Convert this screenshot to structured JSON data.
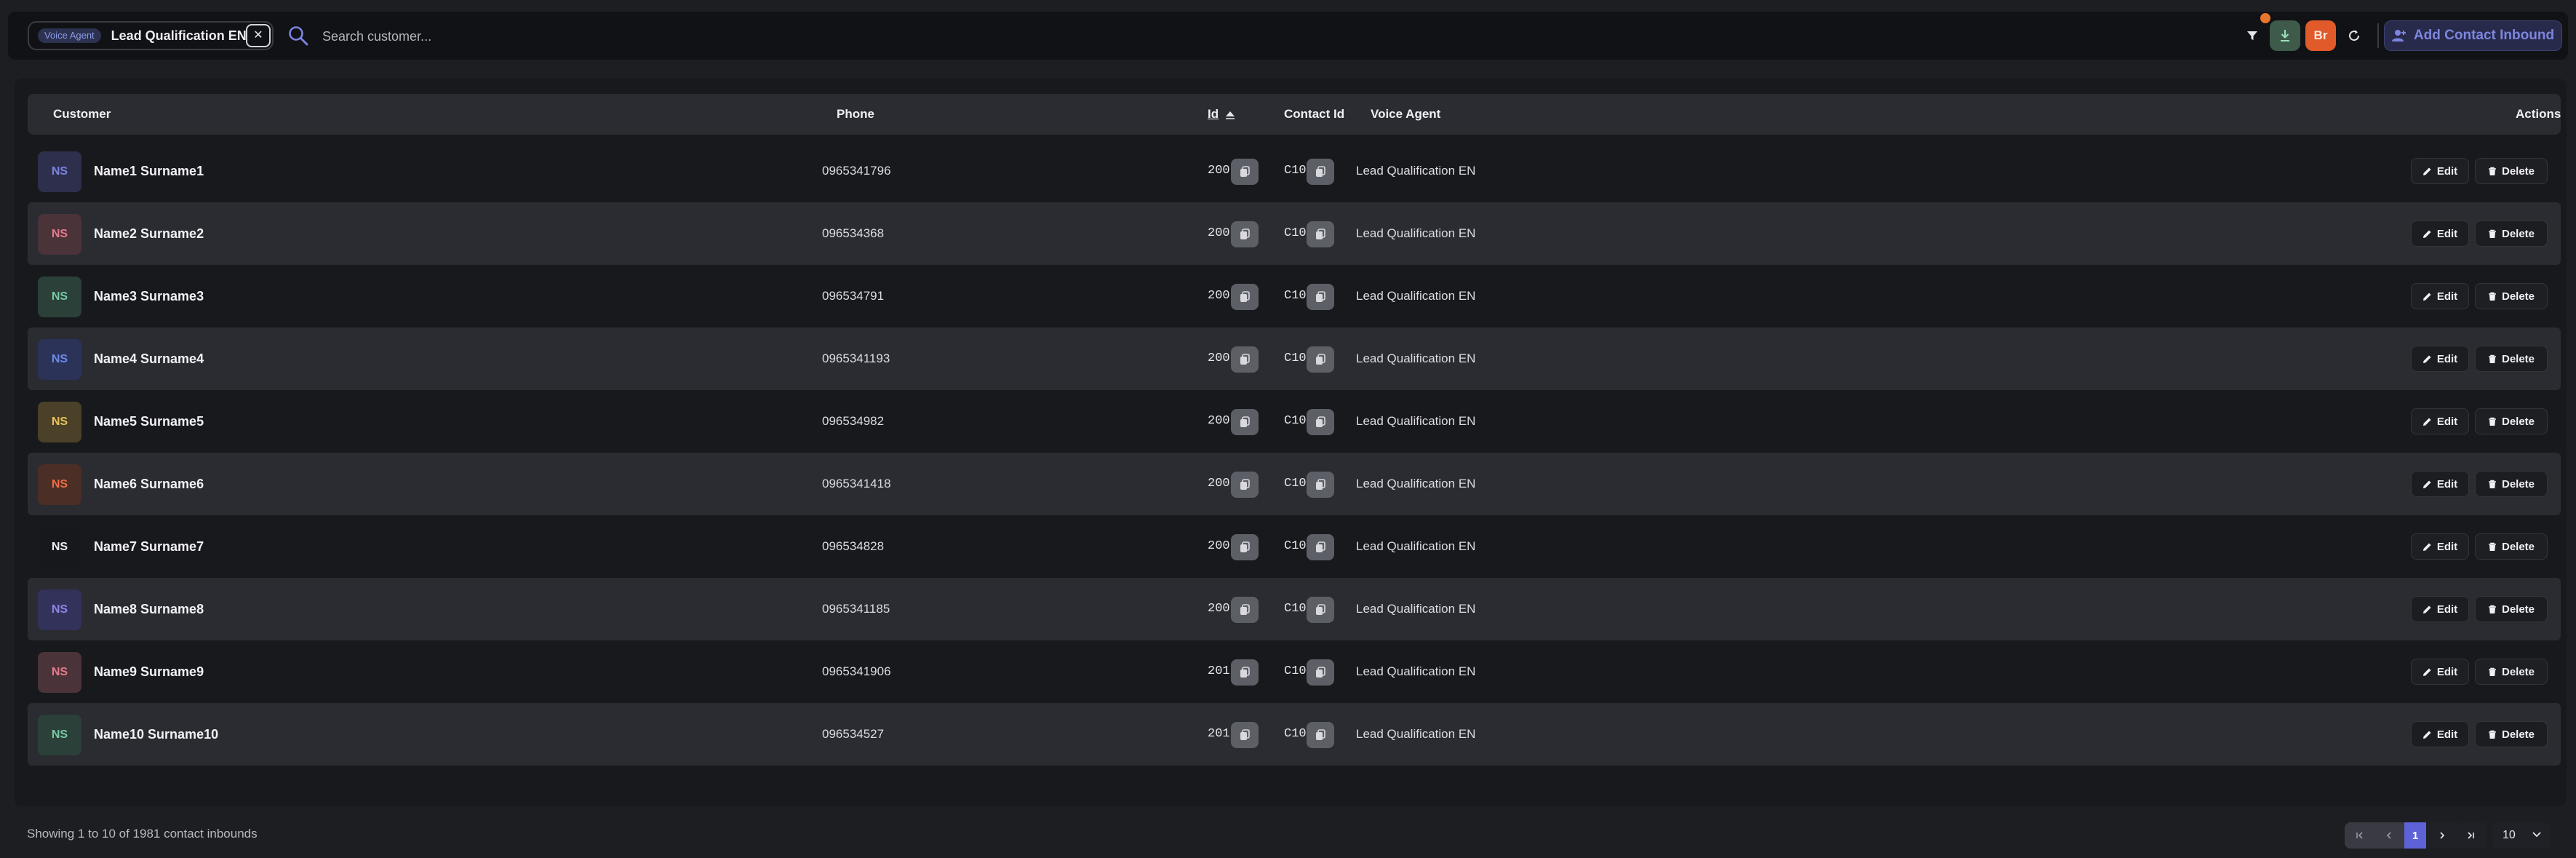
{
  "header": {
    "filter_chip": {
      "label": "Voice Agent",
      "value": "Lead Qualification EN",
      "clear_icon": "close-icon"
    },
    "search": {
      "placeholder": "Search customer...",
      "icon": "search-icon"
    },
    "toolbar": {
      "filter_icon": "filter-icon",
      "download_icon": "download-icon",
      "user_initials": "Br",
      "refresh_icon": "refresh-icon",
      "add_label": "Add Contact Inbound",
      "add_icon": "add-user-icon"
    }
  },
  "table": {
    "columns": {
      "customer": "Customer",
      "phone": "Phone",
      "id": "Id",
      "contact_id": "Contact Id",
      "voice_agent": "Voice Agent",
      "actions": "Actions"
    },
    "edit_label": "Edit",
    "delete_label": "Delete",
    "rows": [
      {
        "initials": "NS",
        "name": "Name1 Surname1",
        "phone": "0965341796",
        "id": "200",
        "contact_id": "C10",
        "agent": "Lead Qualification EN",
        "avatar_bg": "#2d2f4c",
        "avatar_fg": "#7b83e0"
      },
      {
        "initials": "NS",
        "name": "Name2 Surname2",
        "phone": "096534368",
        "id": "200",
        "contact_id": "C10",
        "agent": "Lead Qualification EN",
        "avatar_bg": "#4a3339",
        "avatar_fg": "#e57b8b"
      },
      {
        "initials": "NS",
        "name": "Name3 Surname3",
        "phone": "096534791",
        "id": "200",
        "contact_id": "C10",
        "agent": "Lead Qualification EN",
        "avatar_bg": "#2a4038",
        "avatar_fg": "#77c9a3"
      },
      {
        "initials": "NS",
        "name": "Name4 Surname4",
        "phone": "0965341193",
        "id": "200",
        "contact_id": "C10",
        "agent": "Lead Qualification EN",
        "avatar_bg": "#2b3458",
        "avatar_fg": "#6f87e8"
      },
      {
        "initials": "NS",
        "name": "Name5 Surname5",
        "phone": "096534982",
        "id": "200",
        "contact_id": "C10",
        "agent": "Lead Qualification EN",
        "avatar_bg": "#4a4128",
        "avatar_fg": "#e8c15c"
      },
      {
        "initials": "NS",
        "name": "Name6 Surname6",
        "phone": "0965341418",
        "id": "200",
        "contact_id": "C10",
        "agent": "Lead Qualification EN",
        "avatar_bg": "#4b2e26",
        "avatar_fg": "#ee6d45"
      },
      {
        "initials": "NS",
        "name": "Name7 Surname7",
        "phone": "096534828",
        "id": "200",
        "contact_id": "C10",
        "agent": "Lead Qualification EN",
        "avatar_bg": "#17181b",
        "avatar_fg": "#ececf1"
      },
      {
        "initials": "NS",
        "name": "Name8 Surname8",
        "phone": "0965341185",
        "id": "200",
        "contact_id": "C10",
        "agent": "Lead Qualification EN",
        "avatar_bg": "#33325a",
        "avatar_fg": "#8b86e6"
      },
      {
        "initials": "NS",
        "name": "Name9 Surname9",
        "phone": "0965341906",
        "id": "201",
        "contact_id": "C10",
        "agent": "Lead Qualification EN",
        "avatar_bg": "#4a3339",
        "avatar_fg": "#e57b8b"
      },
      {
        "initials": "NS",
        "name": "Name10 Surname10",
        "phone": "096534527",
        "id": "201",
        "contact_id": "C10",
        "agent": "Lead Qualification EN",
        "avatar_bg": "#2a4038",
        "avatar_fg": "#77c9a3"
      }
    ]
  },
  "footer": {
    "showing_text": "Showing 1 to 10 of 1981 contact inbounds",
    "current_page": "1",
    "page_size": "10"
  }
}
